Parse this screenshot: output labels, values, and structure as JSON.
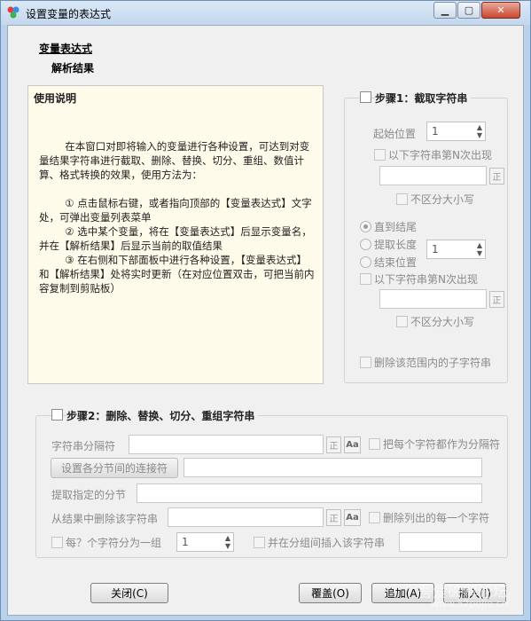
{
  "window": {
    "title": "设置变量的表达式"
  },
  "header": {
    "variable_expression": "变量表达式",
    "parse_result": "解析结果"
  },
  "usage": {
    "title": "使用说明",
    "body": "        在本窗口对即将输入的变量进行各种设置，可达到对变量结果字符串进行截取、删除、替换、切分、重组、数值计算、格式转换的效果，使用方法为：\n\n        ① 点击鼠标右键，或者指向顶部的【变量表达式】文字处，可弹出变量列表菜单\n        ② 选中某个变量，将在【变量表达式】后显示变量名，并在【解析结果】后显示当前的取值结果\n        ③ 在右侧和下部面板中进行各种设置，【变量表达式】和【解析结果】处将实时更新（在对应位置双击，可把当前内容复制到剪贴板）"
  },
  "step1": {
    "title": "步骤1：截取字符串",
    "start_pos_label": "起始位置",
    "start_pos_value": "1",
    "nth_occurrence_label1": "以下字符串第N次出现",
    "case_insensitive_label1": "不区分大小写",
    "regex_label": "正",
    "to_end_label": "直到结尾",
    "extract_length_label": "提取长度",
    "extract_length_value": "1",
    "end_pos_label": "结束位置",
    "nth_occurrence_label2": "以下字符串第N次出现",
    "case_insensitive_label2": "不区分大小写",
    "delete_substring_label": "删除该范围内的子字符串"
  },
  "step2": {
    "title": "步骤2：删除、替换、切分、重组字符串",
    "separator_label": "字符串分隔符",
    "regex_label": "正",
    "case_label": "Aa",
    "each_char_label": "把每个字符都作为分隔符",
    "connector_button": "设置各分节间的连接符",
    "extract_section_label": "提取指定的分节",
    "delete_from_result_label": "从结果中删除该字符串",
    "delete_each_label": "删除列出的每一个字符",
    "group_label": "每？个字符分为一组",
    "group_value": "1",
    "insert_between_label": "并在分组间插入该字符串"
  },
  "footer": {
    "close": "关闭(C)",
    "overwrite": "覆盖(O)",
    "append": "追加(A)",
    "insert": "插入(I)"
  },
  "watermark": {
    "text": "吾爱破解论坛",
    "url": "www.52pojie.cn"
  }
}
